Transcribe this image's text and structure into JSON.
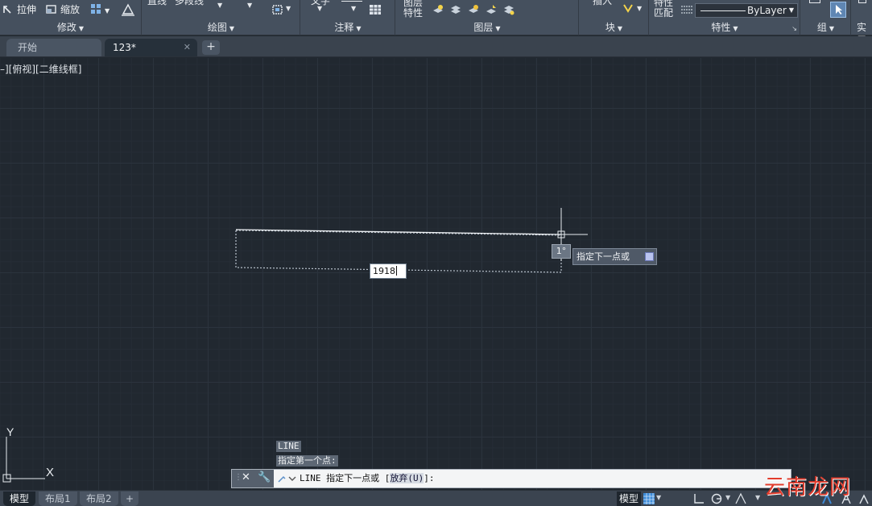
{
  "ribbon": {
    "modify_row": {
      "stretch": "拉伸",
      "scale": "缩放"
    },
    "cut_labels": {
      "line": "直线",
      "polyline": "多段线",
      "text": "文字",
      "insert": "插入",
      "match_1": "特性",
      "match_2": "匹配"
    },
    "layer_props_1": "图层",
    "layer_props_2": "特性",
    "linetype_value": "ByLayer",
    "panels": {
      "modify": "修改",
      "draw": "绘图",
      "annotate": "注释",
      "layers": "图层",
      "block": "块",
      "properties": "特性",
      "group": "组",
      "utilities": "实用"
    }
  },
  "tabs": {
    "start": "开始",
    "drawing": "123*",
    "add": "+",
    "close": "✕"
  },
  "viewport_label": "–][俯视][二维线框]",
  "dynamic_input": {
    "length": "1918",
    "angle": "1°",
    "prompt": "指定下一点或"
  },
  "ucs": {
    "y": "Y",
    "x": "X"
  },
  "command_history": {
    "line1": "LINE",
    "line2": "指定第一个点:"
  },
  "command_line": {
    "prefix": "LINE 指定下一点或 [",
    "option": "放弃(U)",
    "suffix": "]:"
  },
  "layout_tabs": {
    "model": "模型",
    "layout1": "布局1",
    "layout2": "布局2",
    "add": "+"
  },
  "status": {
    "model": "模型"
  },
  "watermark": "云南龙网",
  "colors": {
    "canvas": "#212830",
    "ribbon": "#45505e",
    "accent": "#3d8bd8",
    "watermark": "#e23c2c"
  }
}
